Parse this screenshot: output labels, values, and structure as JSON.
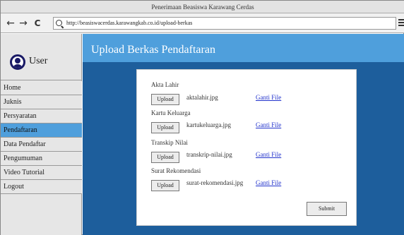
{
  "window": {
    "title": "Penerimaan Beasiswa Karawang Cerdas"
  },
  "browser": {
    "url": "http://beasiswacerdas.karawangkab.co.id/upload-berkas",
    "back_glyph": "←",
    "forward_glyph": "→",
    "refresh_glyph": "C"
  },
  "sidebar": {
    "user_label": "User",
    "items": [
      {
        "label": "Home",
        "active": false
      },
      {
        "label": "Juknis",
        "active": false
      },
      {
        "label": "Persyaratan",
        "active": false
      },
      {
        "label": "Pendaftaran",
        "active": true
      },
      {
        "label": "Data Pendaftar",
        "active": false
      },
      {
        "label": "Pengumuman",
        "active": false
      },
      {
        "label": "Video Tutorial",
        "active": false
      },
      {
        "label": "Logout",
        "active": false
      }
    ]
  },
  "main": {
    "title": "Upload Berkas Pendaftaran",
    "fields": [
      {
        "label": "Akta Lahir",
        "button": "Upload",
        "file": "aktalahir.jpg",
        "link": "Ganti File"
      },
      {
        "label": "Kartu Keluarga",
        "button": "Upload",
        "file": "kartukeluarga.jpg",
        "link": "Ganti File"
      },
      {
        "label": "Transkip Nilai",
        "button": "Upload",
        "file": "transkrip-nilai.jpg",
        "link": "Ganti File"
      },
      {
        "label": "Surat Rekomendasi",
        "button": "Upload",
        "file": "surat-rekomendasi.jpg",
        "link": "Ganti File"
      }
    ],
    "submit_label": "Submit"
  },
  "colors": {
    "main_bg": "#1d5e9c",
    "header_bg": "#4f9fdc",
    "active_nav": "#4f9fdc",
    "link": "#2233cc"
  },
  "icons": {
    "back": "arrow-left-icon",
    "forward": "arrow-right-icon",
    "refresh": "refresh-icon",
    "search": "search-icon",
    "menu": "hamburger-menu-icon",
    "avatar": "user-avatar-icon"
  }
}
